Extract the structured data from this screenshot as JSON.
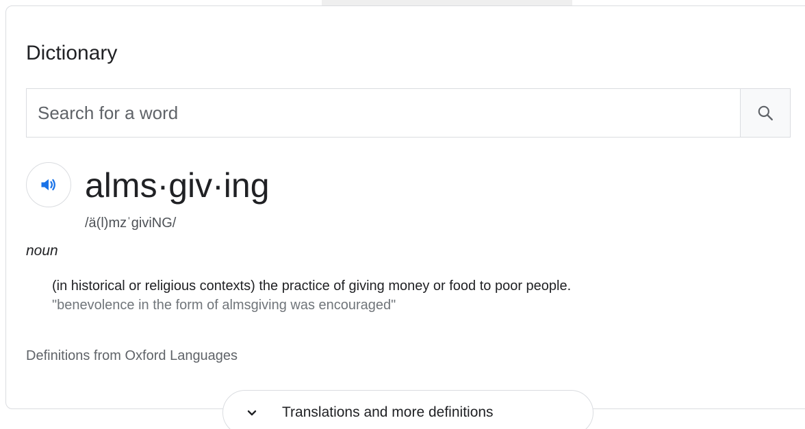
{
  "dictionary": {
    "title": "Dictionary",
    "search": {
      "placeholder": "Search for a word",
      "value": "",
      "icon": "search-icon"
    },
    "entry": {
      "audio_icon": "speaker-icon",
      "headword": "alms·giv·ing",
      "pronunciation": "/ä(l)mzˈɡiviNG/",
      "part_of_speech": "noun",
      "definition": "(in historical or religious contexts) the practice of giving money or food to poor people.",
      "example": "\"benevolence in the form of almsgiving was encouraged\""
    },
    "source": "Definitions from Oxford Languages",
    "more": {
      "label": "Translations and more definitions",
      "icon": "chevron-down-icon"
    }
  },
  "colors": {
    "accent": "#1a73e8",
    "text": "#202124",
    "muted": "#70757a",
    "border": "#dadce0"
  }
}
